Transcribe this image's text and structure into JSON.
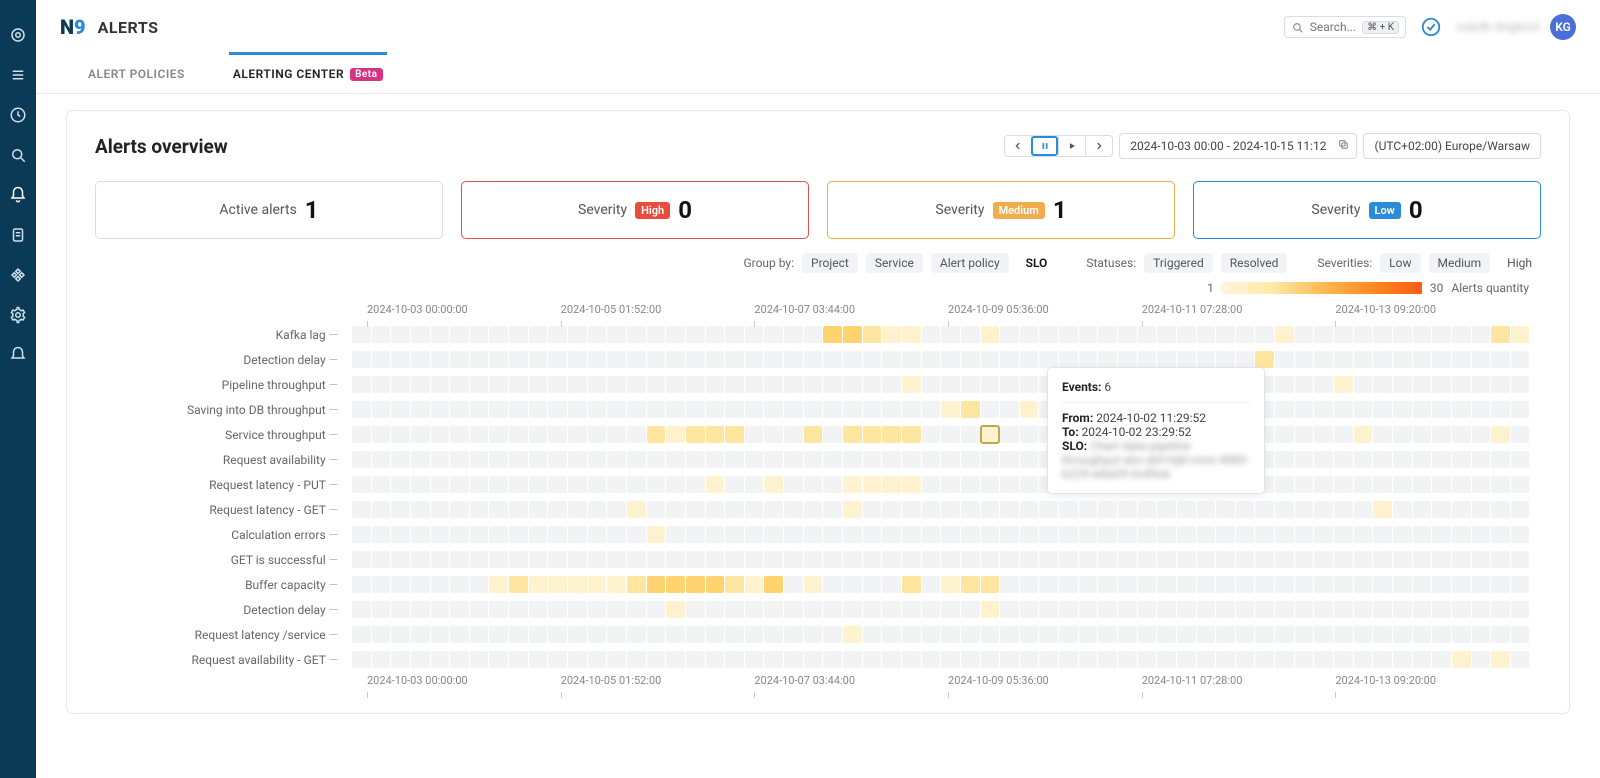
{
  "app": {
    "logo_prefix": "N",
    "logo_suffix": "9",
    "page_title": "ALERTS"
  },
  "topbar": {
    "search_label": "Search...",
    "search_kbd": "⌘ + K",
    "user_name": "nukdh dngknsl",
    "avatar_initials": "KG"
  },
  "tabs": {
    "policies": "ALERT POLICIES",
    "center": "ALERTING CENTER",
    "beta": "Beta"
  },
  "overview": {
    "title": "Alerts overview",
    "time_range": "2024-10-03 00:00 - 2024-10-15 11:12",
    "time_zone": "(UTC+02:00) Europe/Warsaw"
  },
  "kpi": {
    "active_label": "Active alerts",
    "active_count": "1",
    "severity_label": "Severity",
    "high_label": "High",
    "high_count": "0",
    "medium_label": "Medium",
    "medium_count": "1",
    "low_label": "Low",
    "low_count": "0"
  },
  "filters": {
    "group_by_label": "Group by:",
    "group_project": "Project",
    "group_service": "Service",
    "group_policy": "Alert policy",
    "group_slo": "SLO",
    "statuses_label": "Statuses:",
    "status_triggered": "Triggered",
    "status_resolved": "Resolved",
    "severities_label": "Severities:",
    "sev_low": "Low",
    "sev_med": "Medium",
    "sev_high": "High"
  },
  "legend": {
    "min": "1",
    "max": "30",
    "label": "Alerts quantity"
  },
  "chart_data": {
    "type": "heatmap",
    "xlabel": "",
    "ylabel": "",
    "x_ticks": [
      "2024-10-03 00:00:00",
      "2024-10-05 01:52:00",
      "2024-10-07 03:44:00",
      "2024-10-09 05:36:00",
      "2024-10-11 07:28:00",
      "2024-10-13 09:20:00"
    ],
    "y_categories": [
      "Kafka lag",
      "Detection delay",
      "Pipeline throughput",
      "Saving into DB throughput",
      "Service throughput",
      "Request availability",
      "Request latency - PUT",
      "Request latency - GET",
      "Calculation errors",
      "GET is successful",
      "Buffer capacity",
      "Detection delay",
      "Request latency /service",
      "Request availability - GET"
    ],
    "color_scale": {
      "min": 1,
      "max": 30
    },
    "rows": [
      {
        "name": "Kafka lag",
        "cells": [
          [
            24,
            6
          ],
          [
            25,
            5
          ],
          [
            26,
            2
          ],
          [
            27,
            1
          ],
          [
            28,
            1
          ],
          [
            32,
            1
          ],
          [
            47,
            1
          ],
          [
            58,
            2
          ],
          [
            59,
            1
          ]
        ]
      },
      {
        "name": "Detection delay",
        "cells": [
          [
            46,
            2
          ]
        ]
      },
      {
        "name": "Pipeline throughput",
        "cells": [
          [
            28,
            1
          ],
          [
            50,
            1
          ]
        ]
      },
      {
        "name": "Saving into DB throughput",
        "cells": [
          [
            30,
            1
          ],
          [
            31,
            2
          ],
          [
            34,
            1
          ],
          [
            38,
            1
          ]
        ]
      },
      {
        "name": "Service throughput",
        "cells": [
          [
            15,
            2
          ],
          [
            16,
            1
          ],
          [
            17,
            2
          ],
          [
            18,
            2
          ],
          [
            19,
            2
          ],
          [
            23,
            2
          ],
          [
            25,
            2
          ],
          [
            26,
            2
          ],
          [
            27,
            2
          ],
          [
            28,
            2
          ],
          [
            32,
            1
          ],
          [
            51,
            1
          ],
          [
            58,
            1
          ]
        ]
      },
      {
        "name": "Request availability",
        "cells": []
      },
      {
        "name": "Request latency - PUT",
        "cells": [
          [
            18,
            1
          ],
          [
            21,
            1
          ],
          [
            25,
            1
          ],
          [
            26,
            1
          ],
          [
            27,
            1
          ],
          [
            28,
            1
          ]
        ]
      },
      {
        "name": "Request latency - GET",
        "cells": [
          [
            14,
            1
          ],
          [
            25,
            1
          ],
          [
            52,
            1
          ]
        ]
      },
      {
        "name": "Calculation errors",
        "cells": [
          [
            15,
            1
          ]
        ]
      },
      {
        "name": "GET is successful",
        "cells": []
      },
      {
        "name": "Buffer capacity",
        "cells": [
          [
            7,
            1
          ],
          [
            8,
            2
          ],
          [
            9,
            1
          ],
          [
            10,
            1
          ],
          [
            11,
            1
          ],
          [
            12,
            1
          ],
          [
            13,
            1
          ],
          [
            14,
            2
          ],
          [
            15,
            5
          ],
          [
            16,
            5
          ],
          [
            17,
            4
          ],
          [
            18,
            4
          ],
          [
            19,
            3
          ],
          [
            20,
            1
          ],
          [
            21,
            4
          ],
          [
            23,
            1
          ],
          [
            28,
            3
          ],
          [
            30,
            1
          ],
          [
            31,
            2
          ],
          [
            32,
            2
          ]
        ]
      },
      {
        "name": "Detection delay",
        "cells": [
          [
            16,
            1
          ],
          [
            32,
            1
          ]
        ]
      },
      {
        "name": "Request latency /service",
        "cells": [
          [
            25,
            1
          ]
        ]
      },
      {
        "name": "Request availability - GET",
        "cells": [
          [
            56,
            1
          ],
          [
            58,
            1
          ]
        ]
      }
    ],
    "n_cols": 60,
    "highlight": {
      "row": 4,
      "col": 32
    }
  },
  "tooltip": {
    "events_label": "Events:",
    "events_value": "6",
    "from_label": "From:",
    "from_value": "2024-10-02 11:29:52",
    "to_label": "To:",
    "to_value": "2024-10-02 23:29:52",
    "slo_label": "SLO:",
    "slo_value": "Chart data pipeline throughput abc-def-hijkl-mno-4889-k229-wkb09-Ov89ck"
  }
}
